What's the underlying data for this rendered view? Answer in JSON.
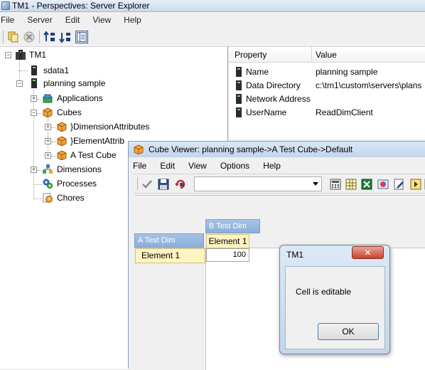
{
  "window": {
    "title": "TM1 - Perspectives: Server Explorer"
  },
  "menu": [
    "File",
    "Server",
    "Edit",
    "View",
    "Help"
  ],
  "tree": {
    "root": "TM1",
    "server": "sdata1",
    "db": "planning sample",
    "applications": "Applications",
    "cubes": "Cubes",
    "cube_items": [
      "}DimensionAttributes",
      "}ElementAttrib",
      "A Test Cube"
    ],
    "dimensions": "Dimensions",
    "processes": "Processes",
    "chores": "Chores"
  },
  "properties": {
    "col_property": "Property",
    "col_value": "Value",
    "rows": [
      {
        "name": "Name",
        "value": "planning sample"
      },
      {
        "name": "Data Directory",
        "value": "c:\\tm1\\custom\\servers\\plans"
      },
      {
        "name": "Network Address",
        "value": ""
      },
      {
        "name": "UserName",
        "value": "ReadDimClient"
      }
    ]
  },
  "cube_viewer": {
    "title": "Cube Viewer: planning sample->A Test Cube->Default",
    "menu": [
      "File",
      "Edit",
      "View",
      "Options",
      "Help"
    ],
    "dropdown_value": "",
    "col_dim": "B Test Dim",
    "row_dim": "A Test Dim",
    "col_element": "Element 1",
    "row_element": "Element 1",
    "cell_value": "100"
  },
  "dialog": {
    "title": "TM1",
    "close": "✕",
    "message": "Cell is editable",
    "ok": "OK"
  }
}
